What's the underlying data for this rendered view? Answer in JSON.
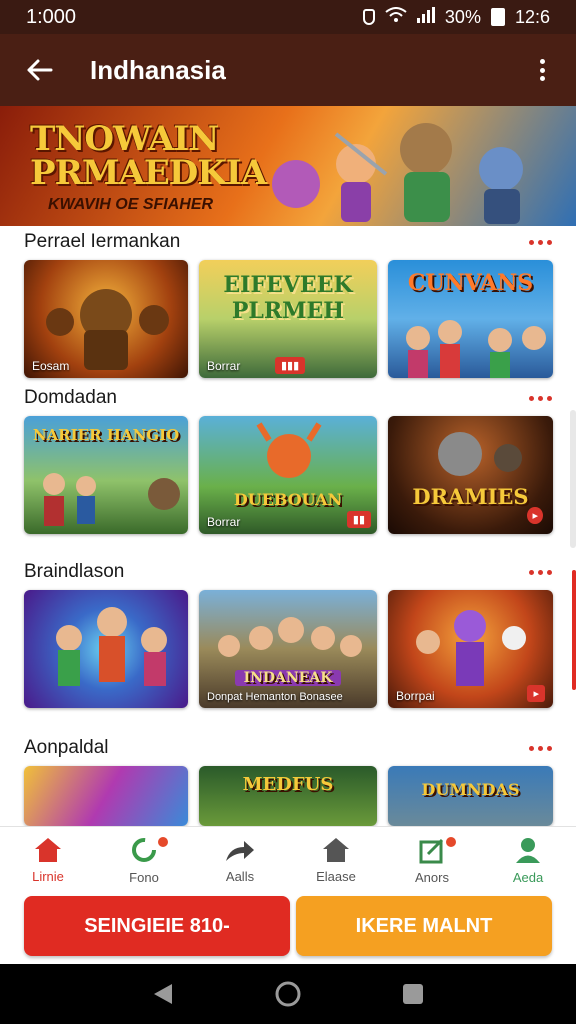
{
  "status_bar": {
    "time": "1:000",
    "battery": "30%",
    "clock": "12:6"
  },
  "app_bar": {
    "title": "Indhanasia"
  },
  "banner": {
    "title_line1": "TNOWAIN",
    "title_line2": "PRMAEDKIA",
    "subtitle": "KWAVIH OE SFIAHER"
  },
  "sections": [
    {
      "title": "Perrael Iermankan",
      "cards": [
        {
          "caption": "Eosam",
          "badge": ""
        },
        {
          "caption": "Borrar",
          "badge": "",
          "text": "EIFEVEEK PLRMEH"
        },
        {
          "caption": "",
          "badge": "",
          "text": "CUNVANS"
        }
      ]
    },
    {
      "title": "Domdadan",
      "cards": [
        {
          "caption": "",
          "badge": "",
          "text": "NARIER HANGIO"
        },
        {
          "caption": "Borrar",
          "badge": "",
          "text": "DUEBOUAN"
        },
        {
          "caption": "",
          "badge": "",
          "text": "DRAMIES"
        }
      ]
    },
    {
      "title": "Braindlason",
      "cards": [
        {
          "caption": "",
          "badge": "",
          "text": ""
        },
        {
          "caption": "Donpat  Hemanton Bonasee",
          "badge": "",
          "text": "INDANEAK"
        },
        {
          "caption": "Borrpai",
          "badge": "",
          "text": ""
        }
      ]
    },
    {
      "title": "Aonpaldal",
      "cards": [
        {
          "caption": "",
          "badge": "",
          "text": ""
        },
        {
          "caption": "",
          "badge": "",
          "text": "MEDFUS"
        },
        {
          "caption": "",
          "badge": "",
          "text": "DUMNDAS"
        }
      ]
    }
  ],
  "bottom_nav": [
    {
      "label": "Lirnie",
      "icon": "home-icon"
    },
    {
      "label": "Fono",
      "icon": "refresh-icon"
    },
    {
      "label": "Aalls",
      "icon": "share-arrow-icon"
    },
    {
      "label": "Elaase",
      "icon": "house-icon"
    },
    {
      "label": "Anors",
      "icon": "edit-box-icon"
    },
    {
      "label": "Aeda",
      "icon": "user-icon"
    }
  ],
  "cta": {
    "left_label": "SEINGIEIE 810-",
    "right_label": "IKERE MALNT"
  },
  "colors": {
    "accent_red": "#d9342b",
    "accent_orange": "#f5a021",
    "app_bar_brown": "#4a1f14"
  }
}
